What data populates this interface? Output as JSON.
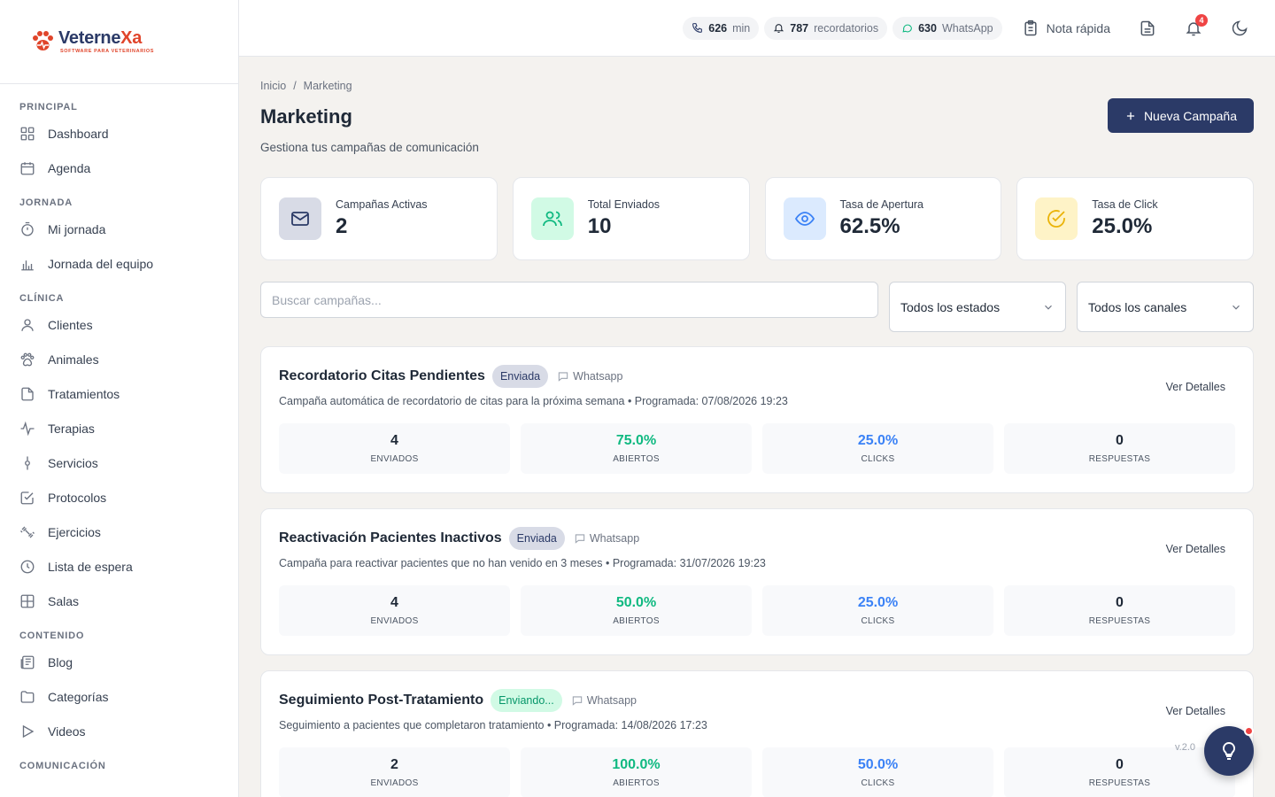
{
  "brand": {
    "name_part1": "Veterne",
    "name_part2": "Xa",
    "tagline": "SOFTWARE PARA VETERINARIOS",
    "accent": "#e0452b",
    "primary": "#2b3a67"
  },
  "sidebar": {
    "sections": [
      {
        "title": "PRINCIPAL",
        "items": [
          {
            "label": "Dashboard",
            "icon": "grid-icon"
          },
          {
            "label": "Agenda",
            "icon": "calendar-icon"
          }
        ]
      },
      {
        "title": "JORNADA",
        "items": [
          {
            "label": "Mi jornada",
            "icon": "timer-icon"
          },
          {
            "label": "Jornada del equipo",
            "icon": "bar-chart-icon"
          }
        ]
      },
      {
        "title": "CLÍNICA",
        "items": [
          {
            "label": "Clientes",
            "icon": "user-icon"
          },
          {
            "label": "Animales",
            "icon": "paw-icon"
          },
          {
            "label": "Tratamientos",
            "icon": "file-icon"
          },
          {
            "label": "Terapias",
            "icon": "activity-icon"
          },
          {
            "label": "Servicios",
            "icon": "pin-icon"
          },
          {
            "label": "Protocolos",
            "icon": "check-square-icon"
          },
          {
            "label": "Ejercicios",
            "icon": "dumbbell-icon"
          },
          {
            "label": "Lista de espera",
            "icon": "clock-icon"
          },
          {
            "label": "Salas",
            "icon": "layout-icon"
          }
        ]
      },
      {
        "title": "CONTENIDO",
        "items": [
          {
            "label": "Blog",
            "icon": "newspaper-icon"
          },
          {
            "label": "Categorías",
            "icon": "folder-icon"
          },
          {
            "label": "Videos",
            "icon": "play-icon"
          }
        ]
      },
      {
        "title": "COMUNICACIÓN",
        "items": []
      }
    ]
  },
  "topbar": {
    "minutes": {
      "value": "626",
      "unit": "min"
    },
    "reminders": {
      "value": "787",
      "unit": "recordatorios"
    },
    "whatsapp": {
      "value": "630",
      "unit": "WhatsApp"
    },
    "quick_note": "Nota rápida",
    "notifications_count": "4"
  },
  "breadcrumb": {
    "home": "Inicio",
    "separator": "/",
    "current": "Marketing"
  },
  "page": {
    "title": "Marketing",
    "subtitle": "Gestiona tus campañas de comunicación",
    "new_button": "Nueva Campaña"
  },
  "stats": [
    {
      "label": "Campañas Activas",
      "value": "2",
      "icon": "mail-icon",
      "bg": "#d8dbe6",
      "fg": "#2b3a67"
    },
    {
      "label": "Total Enviados",
      "value": "10",
      "icon": "users-icon",
      "bg": "#d1fae5",
      "fg": "#10b981"
    },
    {
      "label": "Tasa de Apertura",
      "value": "62.5%",
      "icon": "eye-icon",
      "bg": "#dbeafe",
      "fg": "#3b82f6"
    },
    {
      "label": "Tasa de Click",
      "value": "25.0%",
      "icon": "check-circle-icon",
      "bg": "#fef3c7",
      "fg": "#eab308"
    }
  ],
  "filters": {
    "search_placeholder": "Buscar campañas...",
    "status_select": "Todos los estados",
    "channel_select": "Todos los canales"
  },
  "campaigns": [
    {
      "title": "Recordatorio Citas Pendientes",
      "status": "Enviada",
      "status_type": "sent",
      "channel": "Whatsapp",
      "description": "Campaña automática de recordatorio de citas para la próxima semana • Programada: 07/08/2026 19:23",
      "details": "Ver Detalles",
      "metrics": [
        {
          "value": "4",
          "label": "ENVIADOS"
        },
        {
          "value": "75.0%",
          "label": "ABIERTOS"
        },
        {
          "value": "25.0%",
          "label": "CLICKS"
        },
        {
          "value": "0",
          "label": "RESPUESTAS"
        }
      ]
    },
    {
      "title": "Reactivación Pacientes Inactivos",
      "status": "Enviada",
      "status_type": "sent",
      "channel": "Whatsapp",
      "description": "Campaña para reactivar pacientes que no han venido en 3 meses • Programada: 31/07/2026 19:23",
      "details": "Ver Detalles",
      "metrics": [
        {
          "value": "4",
          "label": "ENVIADOS"
        },
        {
          "value": "50.0%",
          "label": "ABIERTOS"
        },
        {
          "value": "25.0%",
          "label": "CLICKS"
        },
        {
          "value": "0",
          "label": "RESPUESTAS"
        }
      ]
    },
    {
      "title": "Seguimiento Post-Tratamiento",
      "status": "Enviando...",
      "status_type": "sending",
      "channel": "Whatsapp",
      "description": "Seguimiento a pacientes que completaron tratamiento • Programada: 14/08/2026 17:23",
      "details": "Ver Detalles",
      "metrics": [
        {
          "value": "2",
          "label": "ENVIADOS"
        },
        {
          "value": "100.0%",
          "label": "ABIERTOS"
        },
        {
          "value": "50.0%",
          "label": "CLICKS"
        },
        {
          "value": "0",
          "label": "RESPUESTAS"
        }
      ]
    }
  ],
  "version": "v.2.0"
}
